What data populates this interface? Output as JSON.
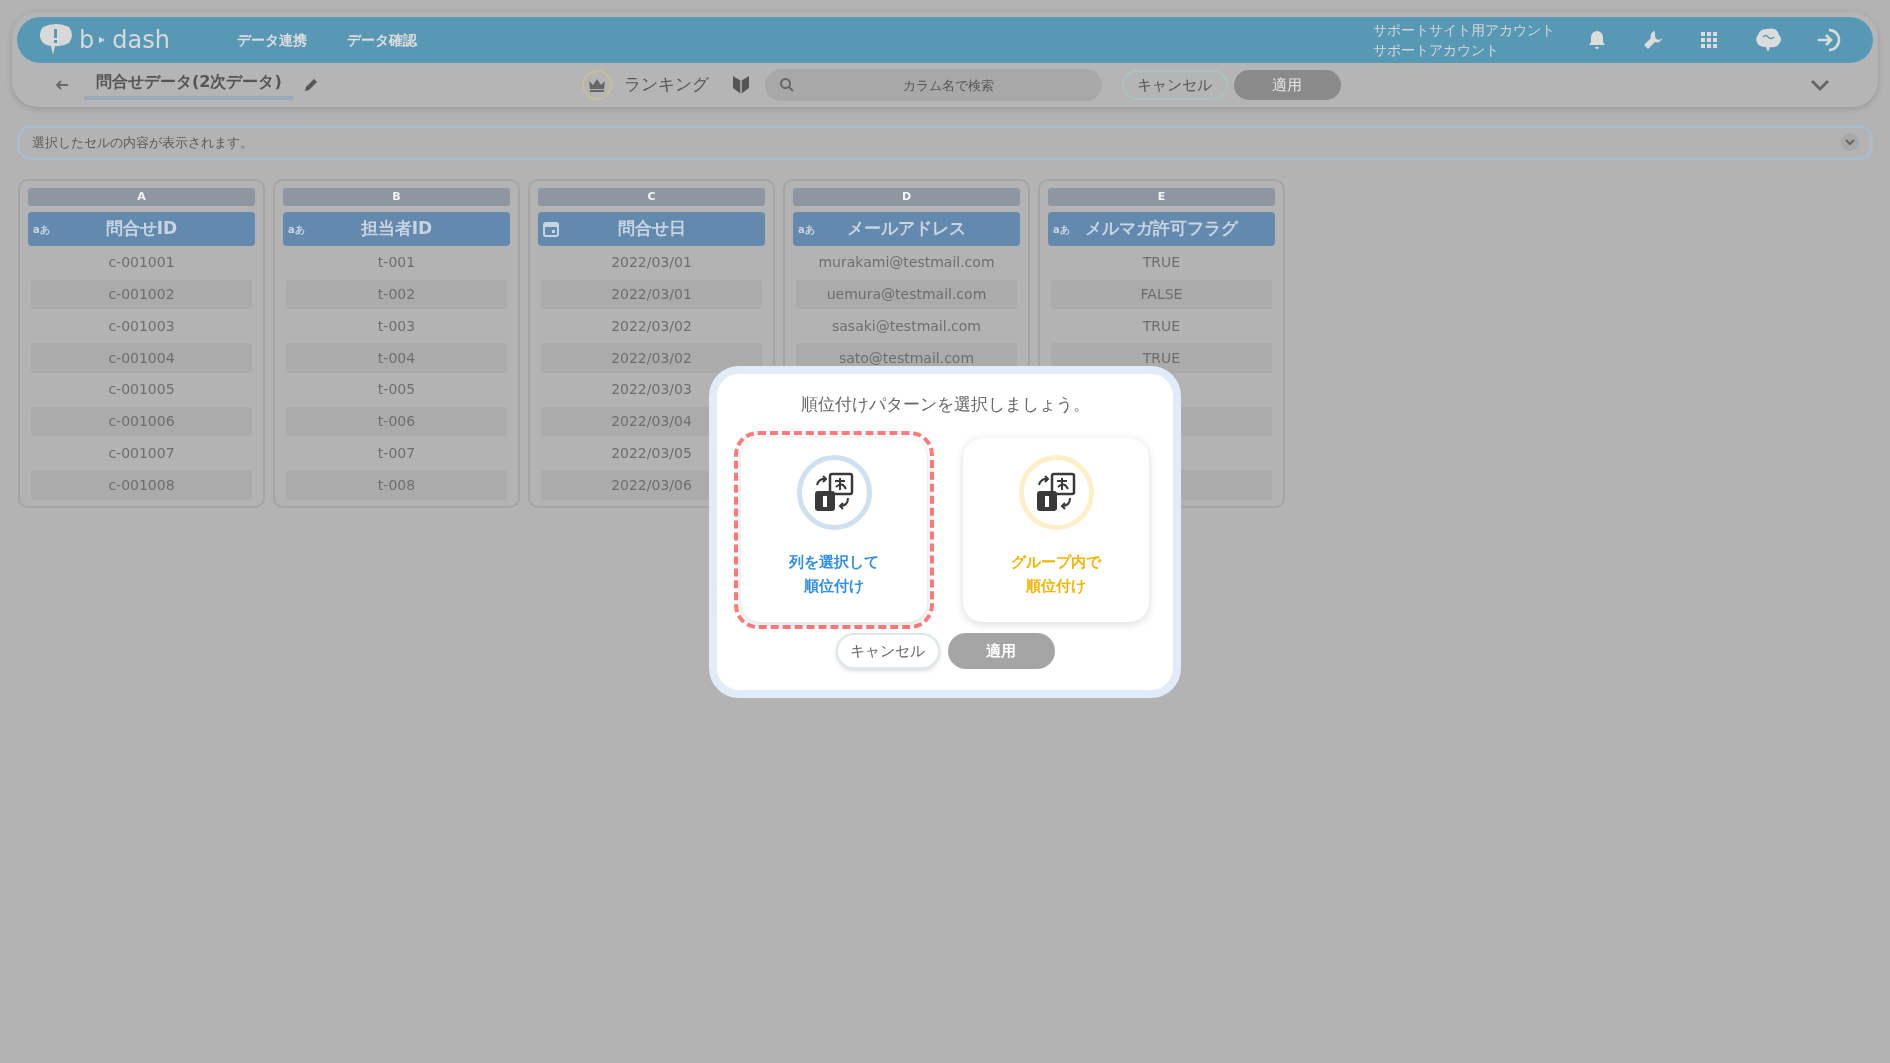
{
  "header": {
    "logo_left": "b",
    "logo_right": "dash",
    "nav": [
      "データ連携",
      "データ確認"
    ],
    "account": [
      "サポートサイト用アカウント",
      "サポートアカウント"
    ]
  },
  "toolbar": {
    "title": "問合せデータ(2次データ)",
    "mode": "ランキング",
    "search": {
      "placeholder": "カラム名で検索"
    },
    "cancel": {
      "label": "キャンセル",
      "disabled": false
    },
    "apply": {
      "label": "適用",
      "disabled": true
    }
  },
  "cell_content": {
    "placeholder": "選択したセルの内容が表示されます。"
  },
  "table": {
    "columns": [
      {
        "letter": "A",
        "name": "問合せID",
        "kind": "text",
        "type_label": "aあ",
        "values": [
          "c-001001",
          "c-001002",
          "c-001003",
          "c-001004",
          "c-001005",
          "c-001006",
          "c-001007",
          "c-001008"
        ]
      },
      {
        "letter": "B",
        "name": "担当者ID",
        "kind": "text",
        "type_label": "aあ",
        "values": [
          "t-001",
          "t-002",
          "t-003",
          "t-004",
          "t-005",
          "t-006",
          "t-007",
          "t-008"
        ]
      },
      {
        "letter": "C",
        "name": "問合せ日",
        "kind": "date",
        "values": [
          "2022/03/01",
          "2022/03/01",
          "2022/03/02",
          "2022/03/02",
          "2022/03/03",
          "2022/03/04",
          "2022/03/05",
          "2022/03/06"
        ]
      },
      {
        "letter": "D",
        "name": "メールアドレス",
        "kind": "text",
        "type_label": "aあ",
        "values": [
          "murakami@testmail.com",
          "uemura@testmail.com",
          "sasaki@testmail.com",
          "sato@testmail.com"
        ]
      },
      {
        "letter": "E",
        "name": "メルマガ許可フラグ",
        "kind": "text",
        "type_label": "aあ",
        "values": [
          "TRUE",
          "FALSE",
          "TRUE",
          "TRUE"
        ]
      }
    ]
  },
  "dialog": {
    "title": "順位付けパターンを選択しましょう。",
    "options": [
      {
        "lines": [
          "列を選択して",
          "順位付け"
        ],
        "color": "#2f8ee6",
        "selected": true
      },
      {
        "lines": [
          "グループ内で",
          "順位付け"
        ],
        "color": "#f5b400",
        "selected": false
      }
    ],
    "cancel": {
      "label": "キャンセル",
      "disabled": false
    },
    "apply": {
      "label": "適用",
      "disabled": true
    }
  }
}
